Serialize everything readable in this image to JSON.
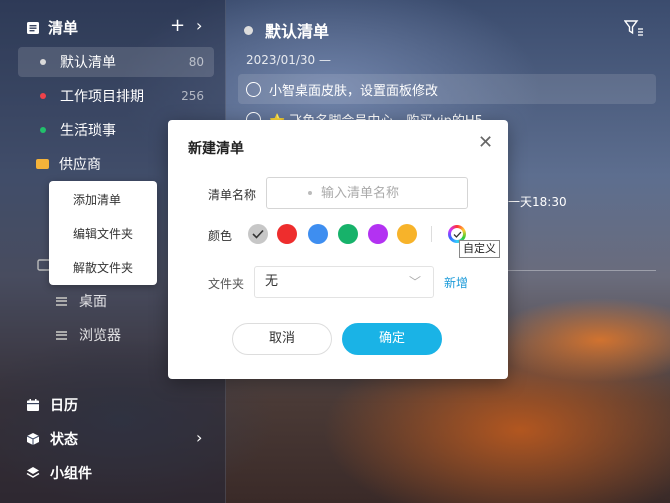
{
  "sidebar": {
    "header": {
      "title": "清单",
      "add_icon": "plus-icon",
      "expand_icon": "chevron-right-icon"
    },
    "lists": [
      {
        "label": "默认清单",
        "count": "80",
        "dot_color": "#d9d9d9"
      },
      {
        "label": "工作项目排期",
        "count": "256",
        "dot_color": "#f0424a"
      },
      {
        "label": "生活琐事",
        "count": "",
        "dot_color": "#21c06b"
      }
    ],
    "folder": {
      "label": "供应商",
      "color": "#f5b33a"
    },
    "context_menu": [
      "添加清单",
      "编辑文件夹",
      "解散文件夹"
    ],
    "sub_items": [
      {
        "label": "桌面"
      },
      {
        "label": "浏览器"
      }
    ],
    "bottom": [
      {
        "label": "日历",
        "icon": "calendar-icon"
      },
      {
        "label": "状态",
        "icon": "cube-icon"
      },
      {
        "label": "小组件",
        "icon": "layers-icon"
      }
    ]
  },
  "main": {
    "title": "默认清单",
    "filter_icon": "filter-icon",
    "date_header": "2023/01/30 —",
    "tasks": [
      {
        "text": "小智桌面皮肤，设置面板修改",
        "highlighted": true
      },
      {
        "text": "⭐ 飞鱼名脚会员中心，购买vip的H5",
        "highlighted": false
      }
    ],
    "partial_due_text": "一天18:30"
  },
  "dialog": {
    "title": "新建清单",
    "name_label": "清单名称",
    "name_placeholder": "输入清单名称",
    "color_label": "颜色",
    "colors": [
      "#c7c7c7",
      "#ee2d2d",
      "#3e8ef0",
      "#17b26a",
      "#b332f2",
      "#f7b32a"
    ],
    "selected_color": "#c7c7c7",
    "custom_tooltip": "自定义",
    "folder_label": "文件夹",
    "folder_value": "无",
    "new_link": "新增",
    "cancel": "取消",
    "confirm": "确定"
  }
}
